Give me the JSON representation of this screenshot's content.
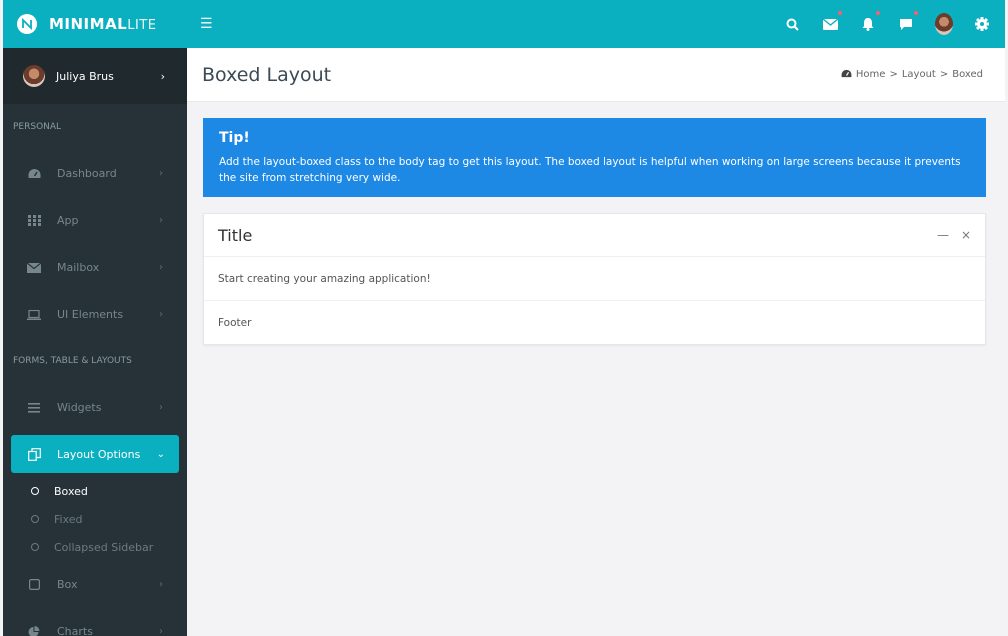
{
  "brand": {
    "bold": "MINIMAL",
    "light": "LITE"
  },
  "header": {
    "menu_icon": "hamburger-icon",
    "icons": [
      "search-icon",
      "mail-icon",
      "bell-icon",
      "chat-icon",
      "avatar",
      "gear-icon"
    ]
  },
  "colors": {
    "accent": "#0ab0bf",
    "sidebar": "#263238",
    "tip": "#1e88e5",
    "notify_dot": "#ff5d6c"
  },
  "user": {
    "name": "Juliya Brus"
  },
  "sidebar": {
    "section_personal": "PERSONAL",
    "section_forms": "FORMS, TABLE & LAYOUTS",
    "items": {
      "dashboard": "Dashboard",
      "app": "App",
      "mailbox": "Mailbox",
      "ui": "UI Elements",
      "widgets": "Widgets",
      "layout": "Layout Options",
      "box": "Box",
      "charts": "Charts"
    },
    "sub": {
      "boxed": "Boxed",
      "fixed": "Fixed",
      "collapsed": "Collapsed Sidebar"
    }
  },
  "page": {
    "title": "Boxed Layout",
    "breadcrumb": {
      "home": "Home",
      "sep": ">",
      "layout": "Layout",
      "current": "Boxed"
    }
  },
  "tip": {
    "title": "Tip!",
    "text": "Add the layout-boxed class to the body tag to get this layout. The boxed layout is helpful when working on large screens because it prevents the site from stretching very wide."
  },
  "box": {
    "title": "Title",
    "body": "Start creating your amazing application!",
    "footer": "Footer"
  }
}
